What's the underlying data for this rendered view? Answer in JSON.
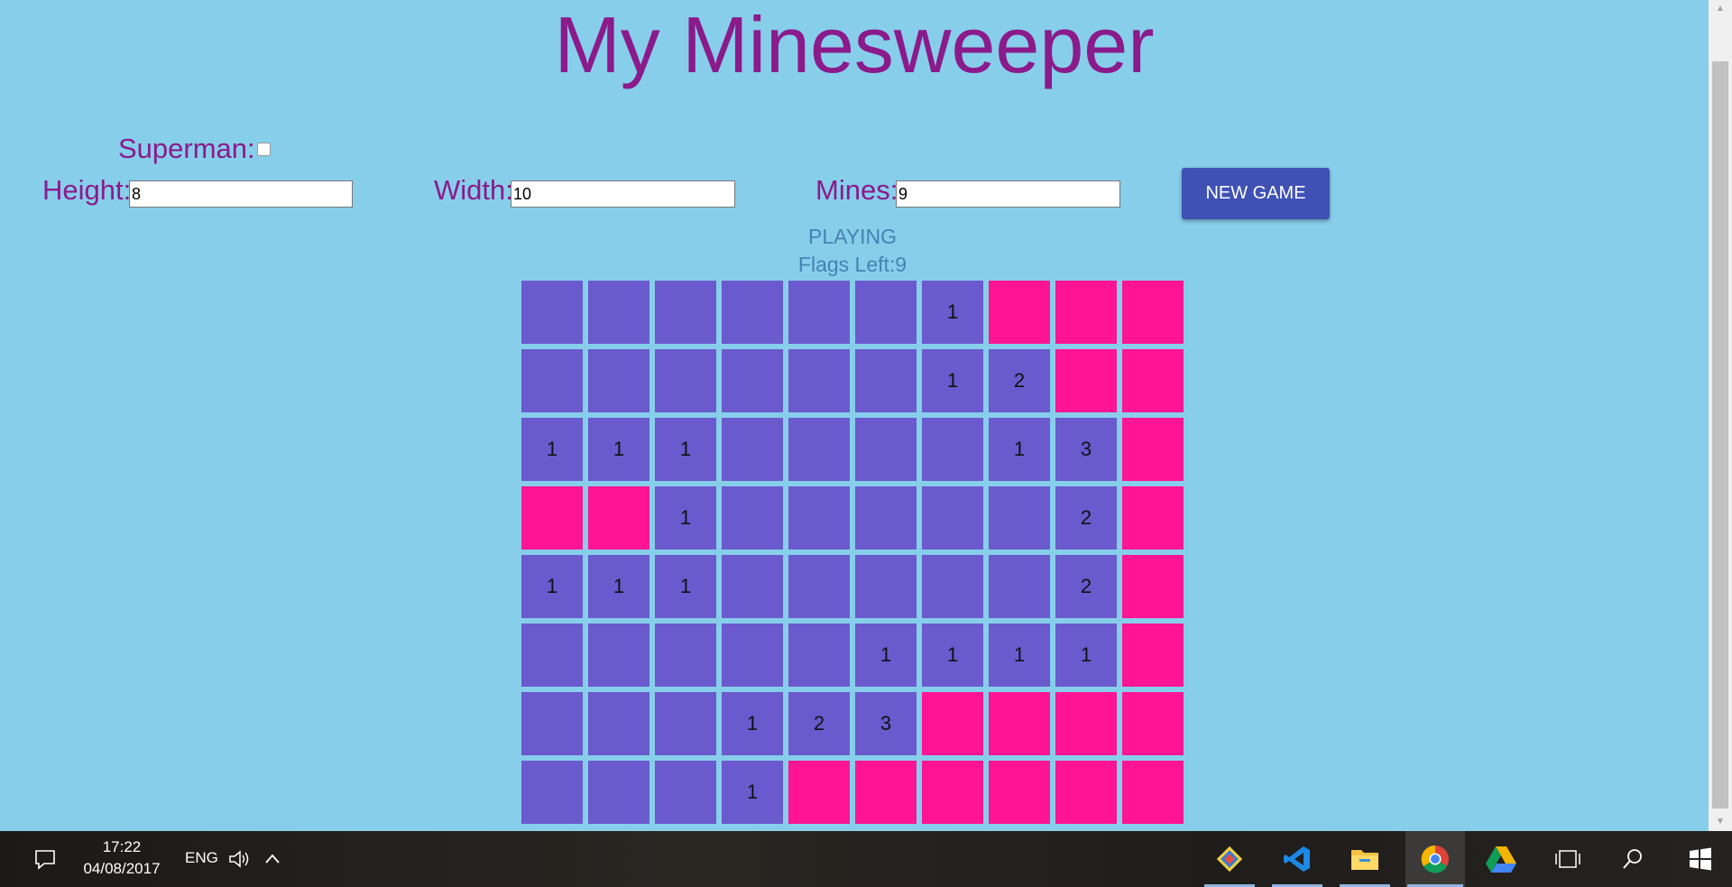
{
  "header": {
    "title": "My Minesweeper"
  },
  "controls": {
    "superman_label": "Superman:",
    "superman_checked": false,
    "height_label": "Height:",
    "height_value": "8",
    "width_label": "Width:",
    "width_value": "10",
    "mines_label": "Mines:",
    "mines_value": "9",
    "new_game_label": "NEW GAME"
  },
  "status": {
    "state": "PLAYING",
    "flags_left": "Flags Left:9"
  },
  "colors": {
    "background": "#87CEEB",
    "title": "#8B1A8B",
    "open_cell": "#6A5ACD",
    "hidden_cell": "#FF1493",
    "button": "#3F51B5",
    "status_text": "#4682B4"
  },
  "board": {
    "legend": "H = hidden cell, 0 = revealed empty, digit = revealed count",
    "rows": [
      [
        "0",
        "0",
        "0",
        "0",
        "0",
        "0",
        "1",
        "H",
        "H",
        "H"
      ],
      [
        "0",
        "0",
        "0",
        "0",
        "0",
        "0",
        "1",
        "2",
        "H",
        "H"
      ],
      [
        "1",
        "1",
        "1",
        "0",
        "0",
        "0",
        "0",
        "1",
        "3",
        "H"
      ],
      [
        "H",
        "H",
        "1",
        "0",
        "0",
        "0",
        "0",
        "0",
        "2",
        "H"
      ],
      [
        "1",
        "1",
        "1",
        "0",
        "0",
        "0",
        "0",
        "0",
        "2",
        "H"
      ],
      [
        "0",
        "0",
        "0",
        "0",
        "0",
        "1",
        "1",
        "1",
        "1",
        "H"
      ],
      [
        "0",
        "0",
        "0",
        "1",
        "2",
        "3",
        "H",
        "H",
        "H",
        "H"
      ],
      [
        "0",
        "0",
        "0",
        "1",
        "H",
        "H",
        "H",
        "H",
        "H",
        "H"
      ]
    ]
  },
  "taskbar": {
    "time": "17:22",
    "date": "04/08/2017",
    "language": "ENG",
    "apps": [
      "git-icon",
      "vscode-icon",
      "file-explorer-icon",
      "chrome-icon",
      "google-drive-icon"
    ],
    "tray_icons": [
      "action-center-icon",
      "volume-icon",
      "chevron-up-icon",
      "task-view-icon",
      "search-icon",
      "windows-start-icon"
    ]
  }
}
